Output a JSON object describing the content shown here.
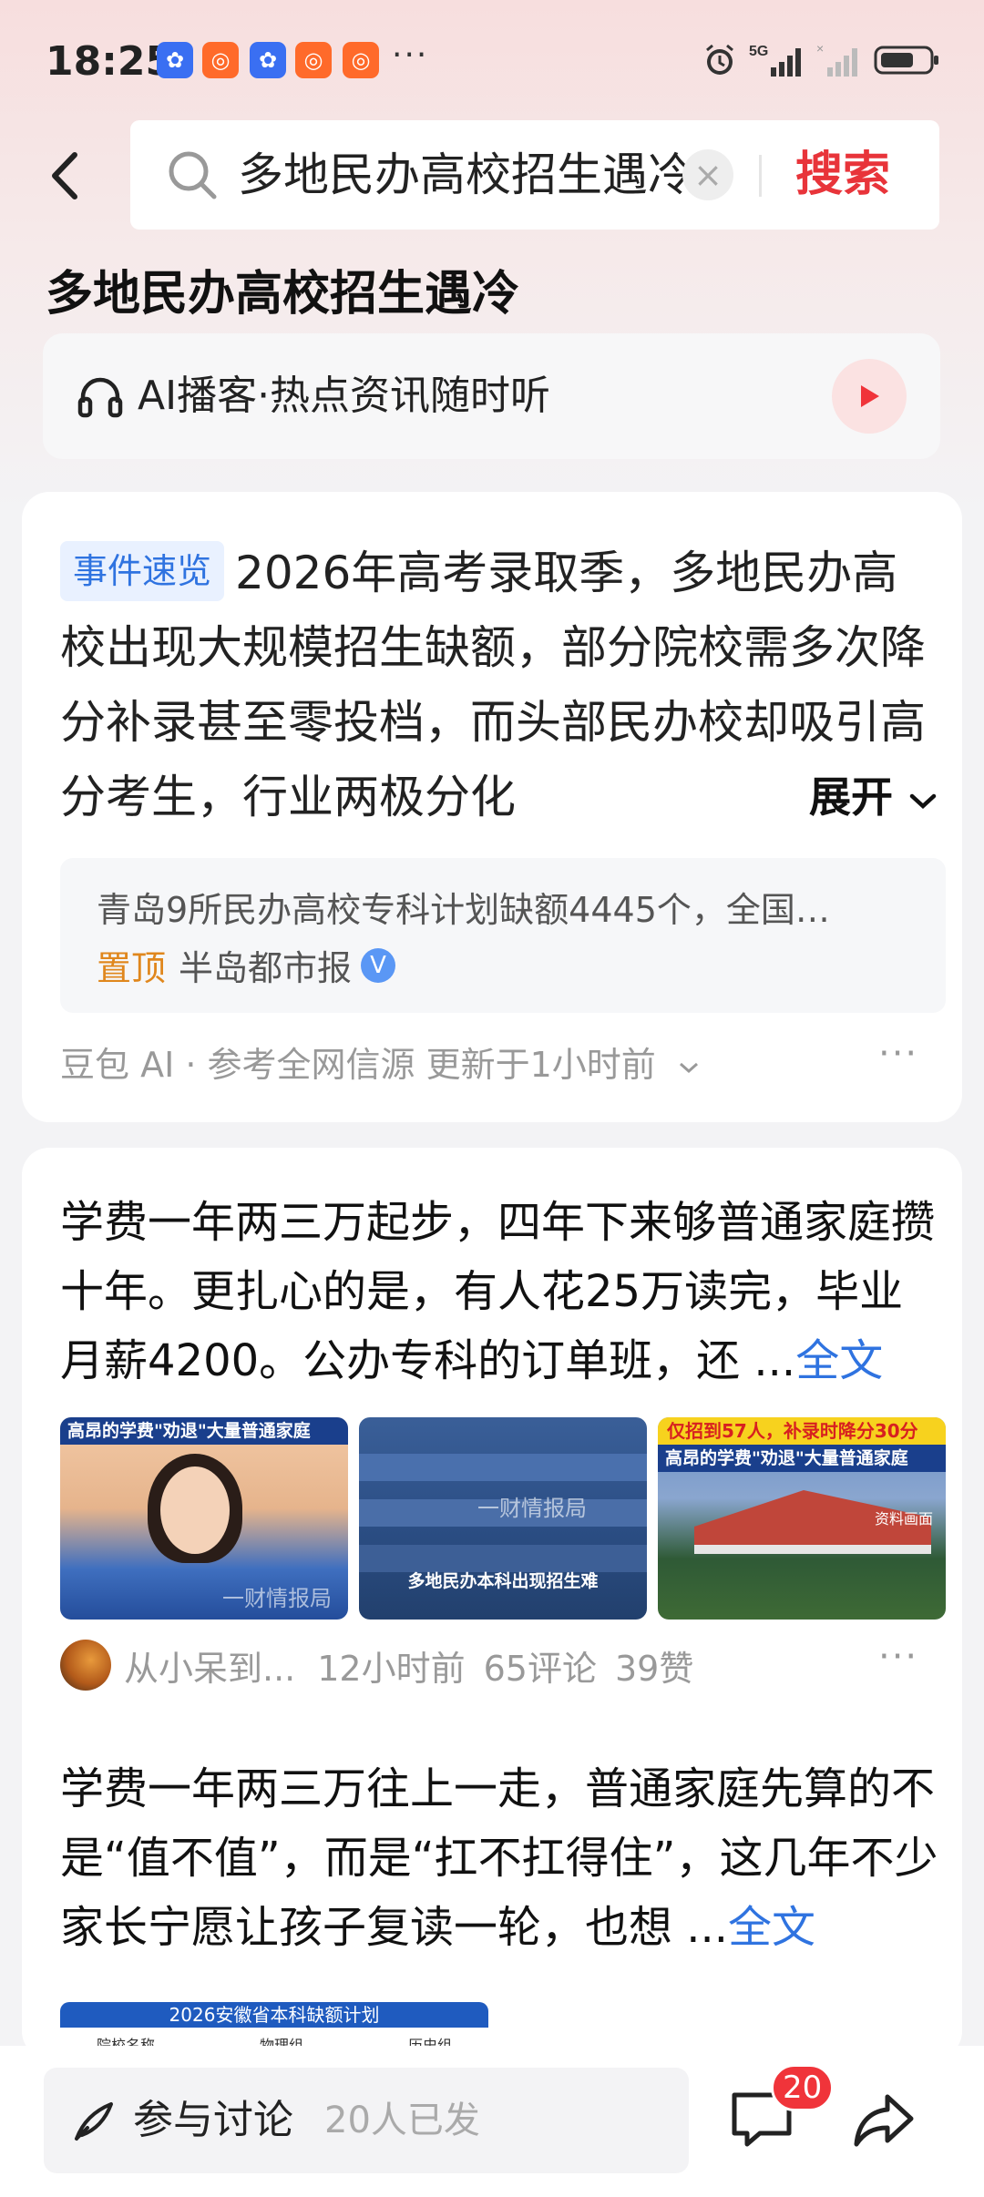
{
  "status_bar": {
    "time": "18:25",
    "app_icons": [
      "baidu-app",
      "app-orange",
      "baidu-app",
      "app-orange",
      "app-orange"
    ],
    "overflow": "···",
    "network": "5G",
    "battery_level": 0.7
  },
  "search": {
    "query": "多地民办高校招生遇冷",
    "clear_label": "×",
    "submit_label": "搜索"
  },
  "page": {
    "title": "多地民办高校招生遇冷"
  },
  "podcast": {
    "label": "AI播客·热点资讯随时听"
  },
  "summary_card": {
    "tag": "事件速览",
    "text": "2026年高考录取季，多地民办高校出现大规模招生缺额，部分院校需多次降分补录甚至零投档，而头部民办校却吸引高分考生，行业两极分化",
    "expand_label": "展开",
    "source_headline": "青岛9所民办高校专科计划缺额4445个，全国…",
    "pin_label": "置顶",
    "source_name": "半岛都市报",
    "verified_badge": "V",
    "meta": "豆包 AI · 参考全网信源 更新于1小时前",
    "more": "···"
  },
  "posts": [
    {
      "text": "学费一年两三万起步，四年下来够普通家庭攒十年。更扎心的是，有人花25万读完，毕业月薪4200。公办专科的订单班，还 ...",
      "full_label": "全文",
      "images": [
        {
          "banner": "高昂的学费\"劝退\"大量普通家庭",
          "watermark": "一财情报局"
        },
        {
          "caption": "多地民办本科出现招生难",
          "watermark": "一财情报局"
        },
        {
          "banner_top": "仅招到57人，补录时降分30分",
          "banner": "高昂的学费\"劝退\"大量普通家庭",
          "note": "资料画面"
        }
      ],
      "author": "从小呆到...",
      "time": "12小时前",
      "comments": "65评论",
      "likes": "39赞",
      "more": "···"
    },
    {
      "text": "学费一年两三万往上一走，普通家庭先算的不是“值不值”，而是“扛不扛得住”，这几年不少家长宁愿让孩子复读一轮，也想 ...",
      "full_label": "全文",
      "table_thumb": {
        "title": "2026安徽省本科缺额计划",
        "columns": [
          "院校名称",
          "物理组",
          "历史组"
        ]
      }
    }
  ],
  "bottom_bar": {
    "discuss_label": "参与讨论",
    "discuss_count": "20人已发",
    "comment_badge": "20"
  },
  "colors": {
    "accent_red": "#e8343a",
    "link_blue": "#2f73e0",
    "pin_orange": "#e0871d"
  }
}
